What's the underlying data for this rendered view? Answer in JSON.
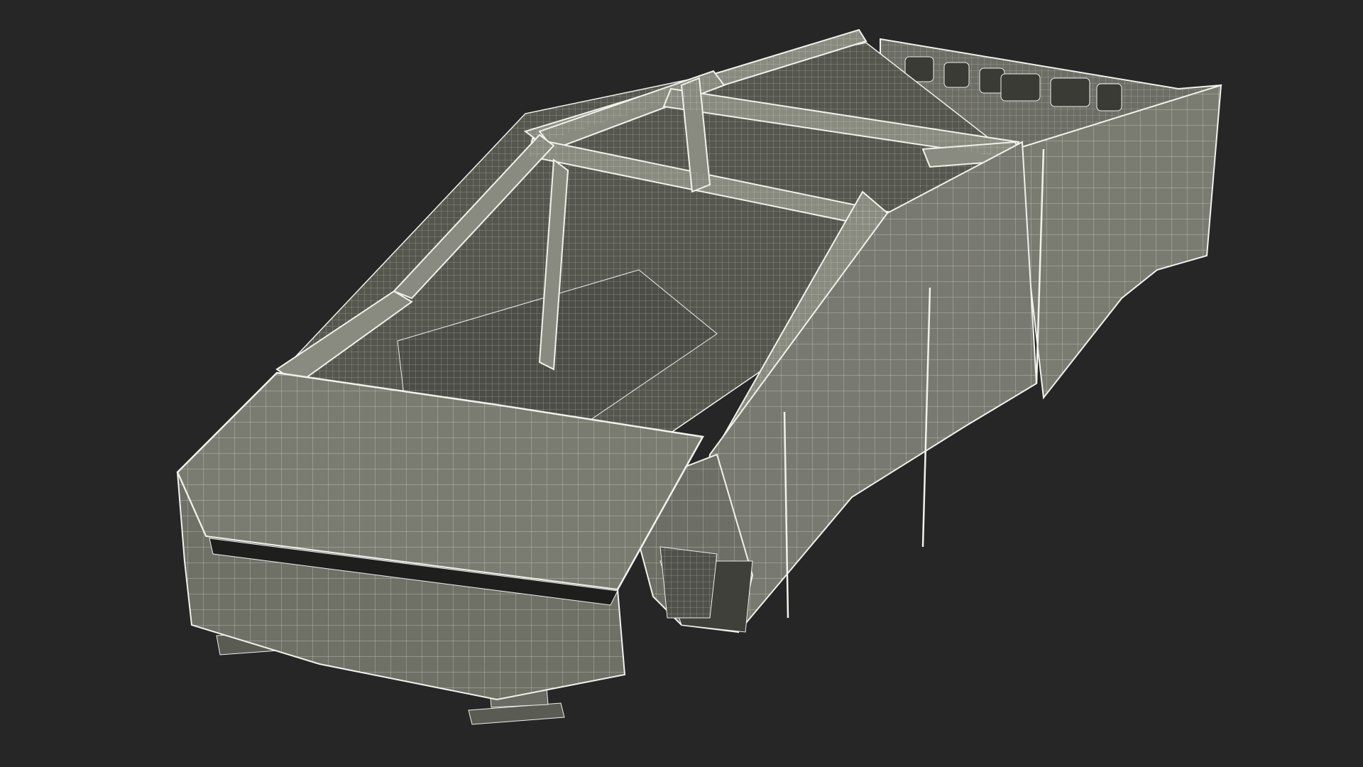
{
  "scene": {
    "background_color": "#262626",
    "subject": "truck-body-frame-wireframe",
    "render_style": "wireframe-clay",
    "colors": {
      "surface": "#73746a",
      "surface_light": "#8a8b80",
      "surface_dark": "#4a4b43",
      "interior": "#55564e",
      "wire": "#f2f2ec"
    }
  }
}
